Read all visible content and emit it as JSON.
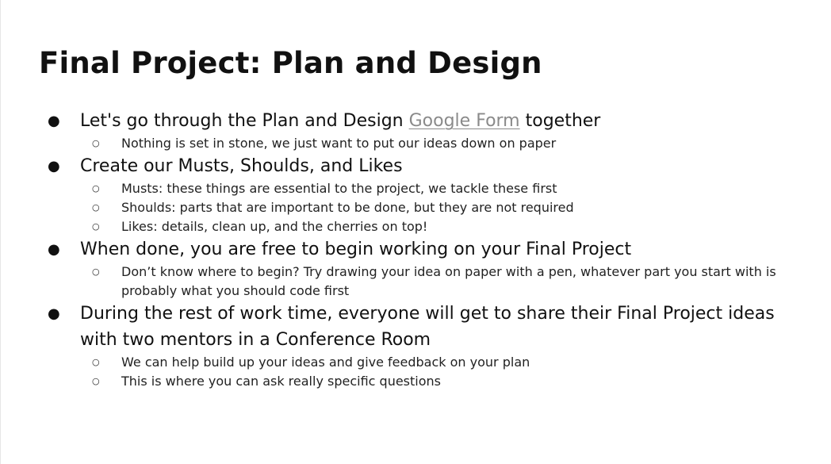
{
  "slide": {
    "title": "Final Project: Plan and Design",
    "bullet_glyph": "●",
    "sub_bullet_glyph": "○",
    "items": [
      {
        "pre": "Let's go through the Plan and Design ",
        "link": "Google Form",
        "post": " together",
        "subitems": [
          "Nothing is set in stone, we just want to put our ideas down on paper"
        ]
      },
      {
        "text": "Create our Musts, Shoulds, and Likes",
        "subitems": [
          "Musts: these things are essential to the project, we tackle these first",
          "Shoulds: parts that are important to be done, but they are not required",
          "Likes: details, clean up, and the cherries on top!"
        ]
      },
      {
        "text": "When done, you are free to begin working on your Final Project",
        "subitems": [
          "Don’t know where to begin? Try drawing your idea on paper with a pen, whatever part you start with is probably what you should code first"
        ]
      },
      {
        "text": "During the rest of work time, everyone will get to share their Final Project ideas with two mentors in a Conference Room",
        "subitems": [
          "We can help build up your ideas and give feedback on your plan",
          "This is where you can ask really specific questions"
        ]
      }
    ]
  },
  "colors": {
    "text": "#111111",
    "link": "#8a8a8a",
    "background": "#ffffff"
  }
}
